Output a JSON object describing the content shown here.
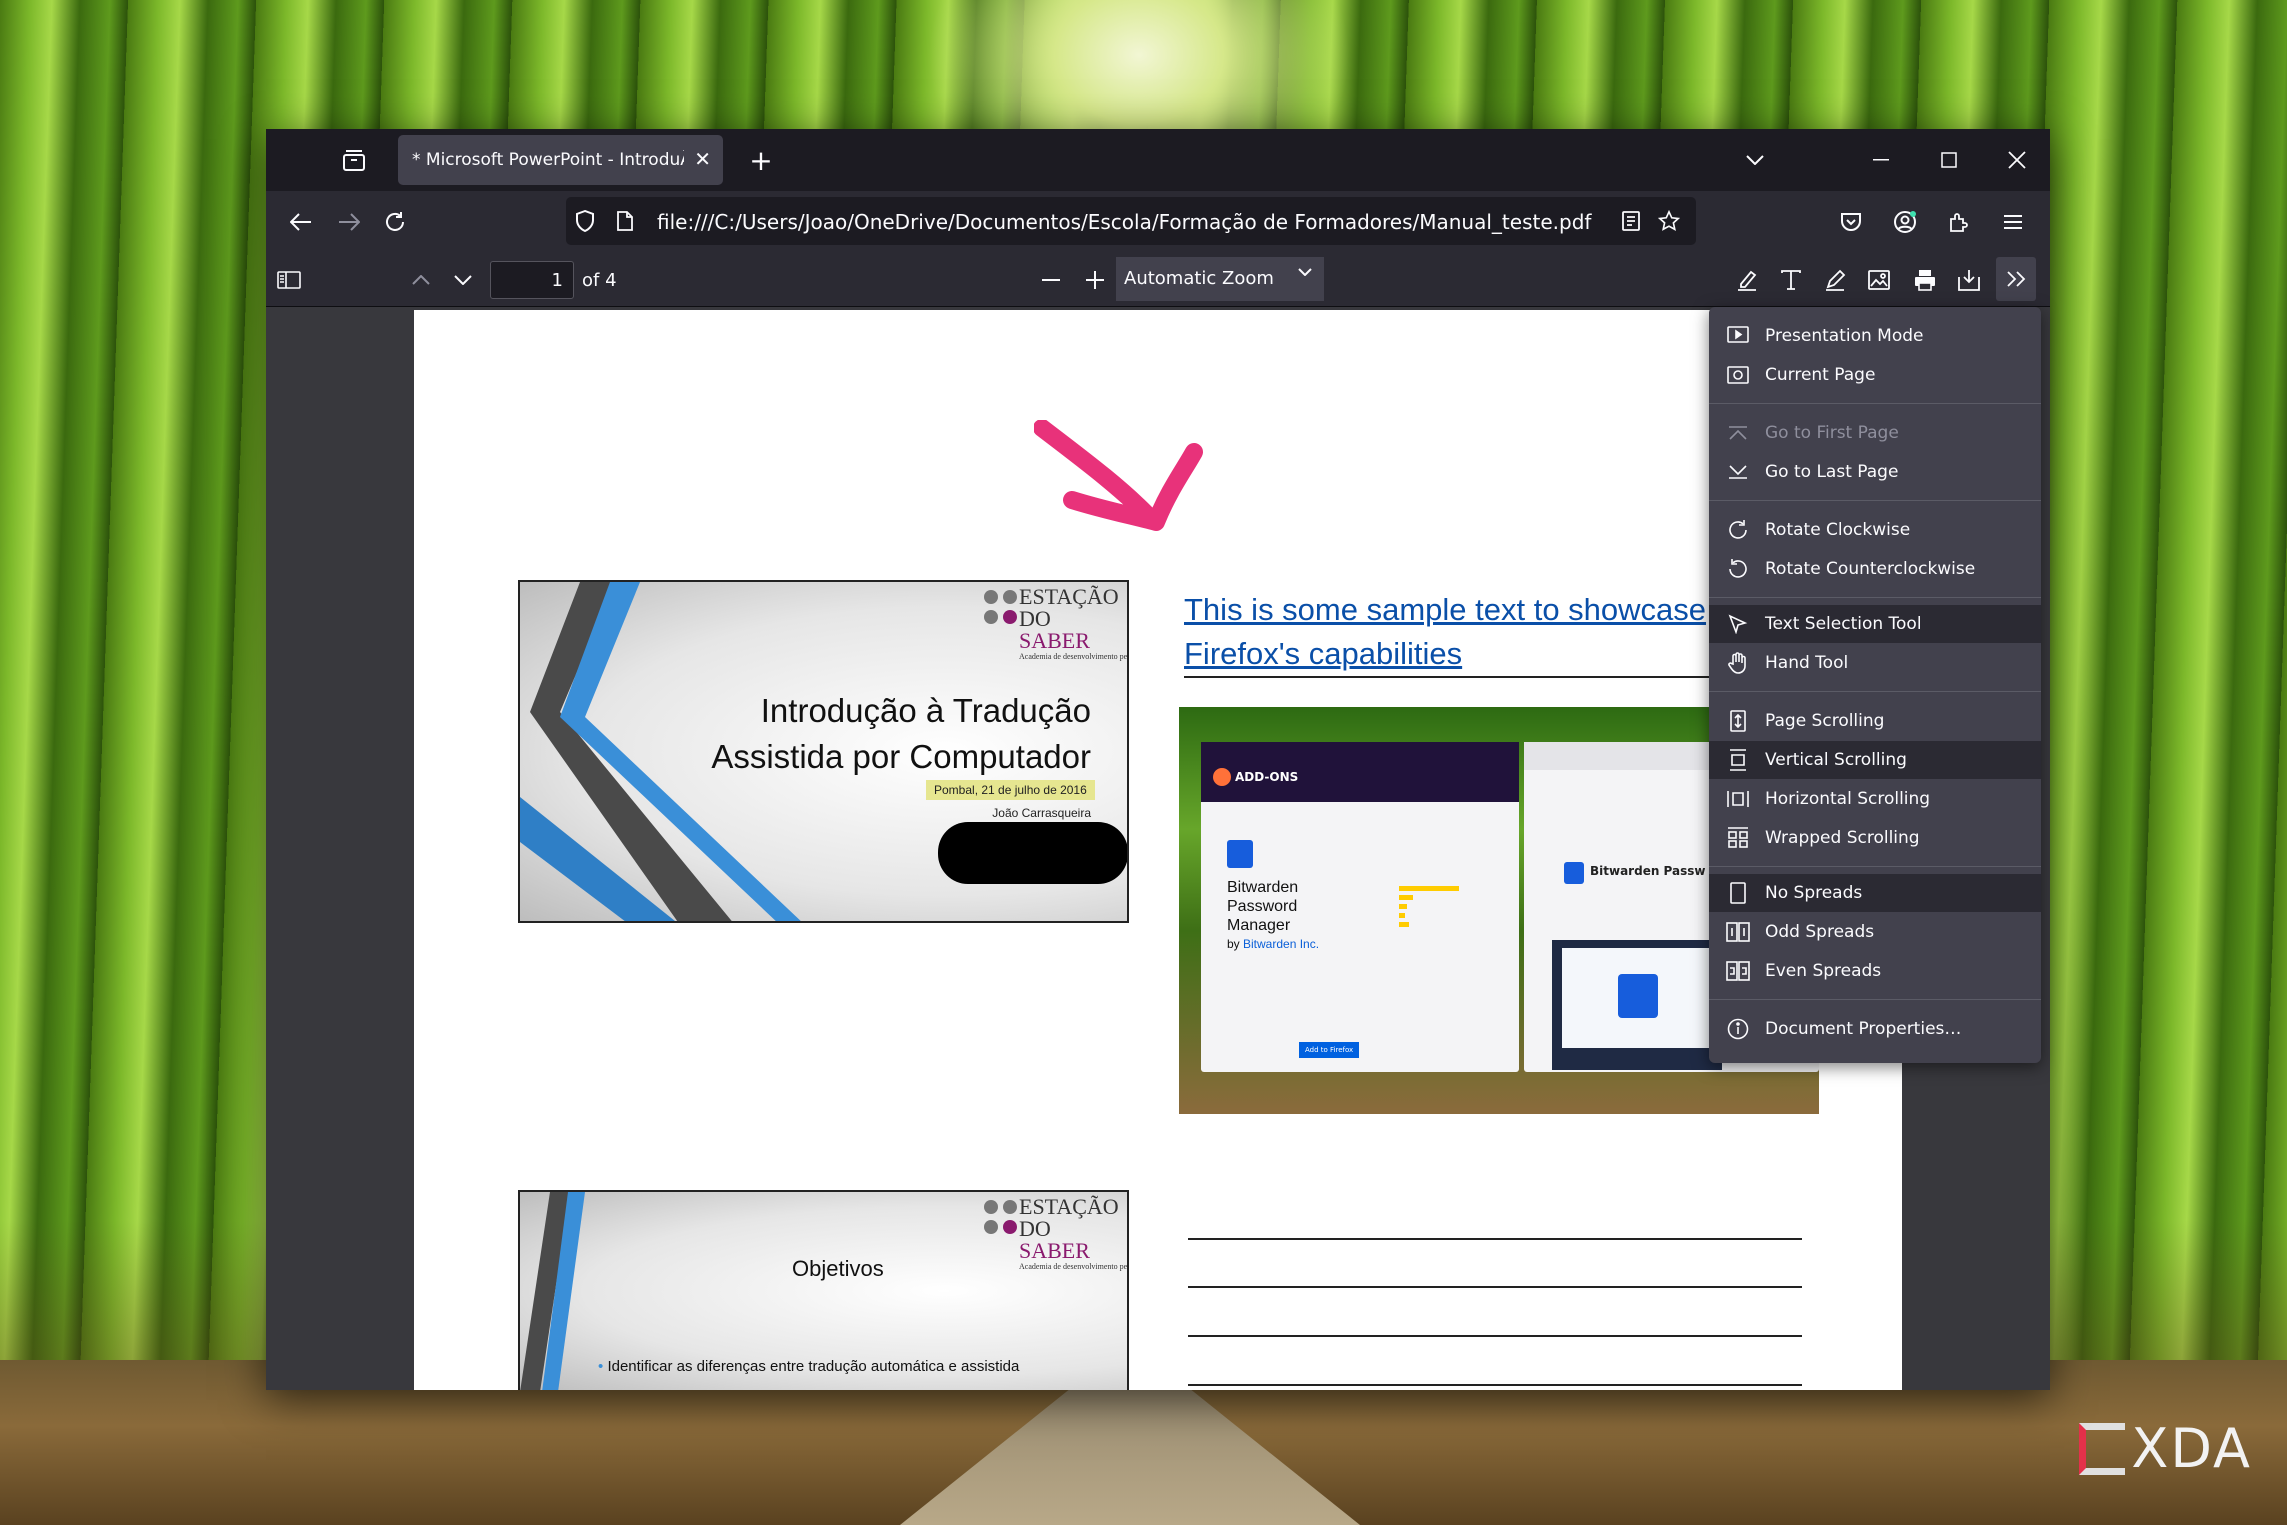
{
  "watermark": {
    "brand": "XDA"
  },
  "window": {
    "tab_title": "* Microsoft PowerPoint - IntroduÃ§",
    "url": "file:///C:/Users/Joao/OneDrive/Documentos/Escola/Formação de Formadores/Manual_teste.pdf"
  },
  "pdf_toolbar": {
    "page_number": "1",
    "page_count": "of 4",
    "zoom": "Automatic Zoom"
  },
  "document": {
    "slide1": {
      "logo_top": "ESTAÇÃO",
      "logo_do": "DO ",
      "logo_saber": "SABER",
      "logo_sub": "Academia de desenvolvimento pessoal",
      "title_line1": "Introdução à Tradução",
      "title_line2": "Assistida por Computador",
      "date": "Pombal, 21 de julho de 2016",
      "author": "João Carrasqueira"
    },
    "link_line1": "This is some sample text to showcase",
    "link_line2": "Firefox's capabilities",
    "screenshot": {
      "site": "ADD-ONS",
      "addon_name_1": "Bitwarden",
      "addon_name_2": "Password",
      "addon_name_3": "Manager",
      "by": "by ",
      "author": "Bitwarden Inc.",
      "button": "Add to Firefox",
      "store_title": "Bitwarden Passw"
    },
    "slide2": {
      "logo_top": "ESTAÇÃO",
      "logo_do": "DO ",
      "logo_saber": "SABER",
      "logo_sub": "Academia de desenvolvimento pessoal",
      "title": "Objetivos",
      "bullet1": "Identificar as diferenças entre tradução automática e assistida"
    }
  },
  "menu": {
    "items": [
      {
        "label": "Presentation Mode",
        "icon": "presentation-icon",
        "state": "normal"
      },
      {
        "label": "Current Page",
        "icon": "current-page-icon",
        "state": "normal"
      },
      {
        "label": "Go to First Page",
        "icon": "first-page-icon",
        "state": "disabled"
      },
      {
        "label": "Go to Last Page",
        "icon": "last-page-icon",
        "state": "normal"
      },
      {
        "label": "Rotate Clockwise",
        "icon": "rotate-cw-icon",
        "state": "normal"
      },
      {
        "label": "Rotate Counterclockwise",
        "icon": "rotate-ccw-icon",
        "state": "normal"
      },
      {
        "label": "Text Selection Tool",
        "icon": "text-select-icon",
        "state": "selected"
      },
      {
        "label": "Hand Tool",
        "icon": "hand-icon",
        "state": "normal"
      },
      {
        "label": "Page Scrolling",
        "icon": "page-scroll-icon",
        "state": "normal"
      },
      {
        "label": "Vertical Scrolling",
        "icon": "vertical-scroll-icon",
        "state": "selected"
      },
      {
        "label": "Horizontal Scrolling",
        "icon": "horizontal-scroll-icon",
        "state": "normal"
      },
      {
        "label": "Wrapped Scrolling",
        "icon": "wrapped-scroll-icon",
        "state": "normal"
      },
      {
        "label": "No Spreads",
        "icon": "no-spreads-icon",
        "state": "selected"
      },
      {
        "label": "Odd Spreads",
        "icon": "odd-spreads-icon",
        "state": "normal"
      },
      {
        "label": "Even Spreads",
        "icon": "even-spreads-icon",
        "state": "normal"
      },
      {
        "label": "Document Properties…",
        "icon": "info-icon",
        "state": "normal"
      }
    ]
  },
  "colors": {
    "annotation_arrow": "#e8327a",
    "link": "#0a4fa8",
    "menu_bg": "#42414d"
  }
}
